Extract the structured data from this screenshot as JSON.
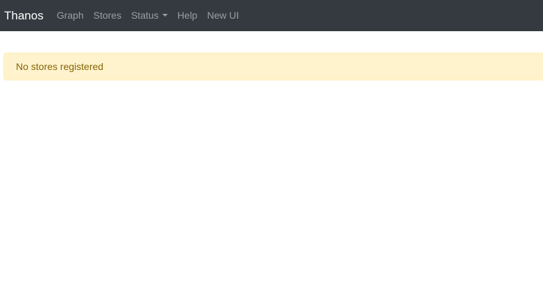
{
  "navbar": {
    "brand": "Thanos",
    "links": [
      {
        "label": "Graph"
      },
      {
        "label": "Stores"
      },
      {
        "label": "Status"
      },
      {
        "label": "Help"
      },
      {
        "label": "New UI"
      }
    ]
  },
  "main": {
    "alert_text": "No stores registered"
  },
  "colors": {
    "navbar_bg": "#343a40",
    "alert_bg": "#fff3cd",
    "alert_text": "#856404"
  }
}
